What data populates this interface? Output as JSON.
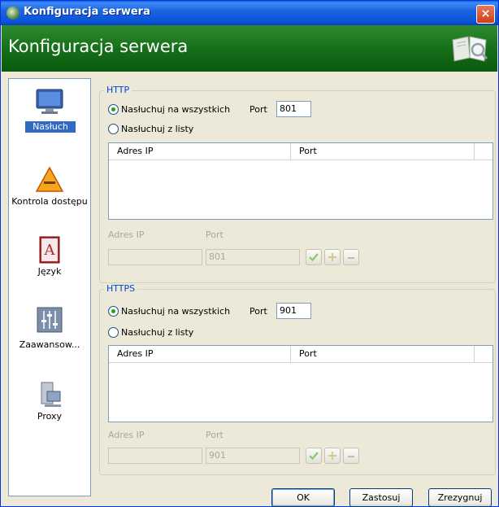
{
  "window": {
    "title": "Konfiguracja serwera",
    "close": "×"
  },
  "banner": {
    "title": "Konfiguracja serwera"
  },
  "sidebar": {
    "items": [
      {
        "label": "Nasłuch",
        "icon": "monitor-icon"
      },
      {
        "label": "Kontrola dostępu",
        "icon": "warning-icon"
      },
      {
        "label": "Język",
        "icon": "dictionary-icon"
      },
      {
        "label": "Zaawansow...",
        "icon": "sliders-icon"
      },
      {
        "label": "Proxy",
        "icon": "computer-icon"
      }
    ]
  },
  "http": {
    "title": "HTTP",
    "listen_all": "Nasłuchuj na wszystkich",
    "port_label": "Port",
    "port_value": "801",
    "listen_list": "Nasłuchuj z listy",
    "col_ip": "Adres IP",
    "col_port": "Port",
    "ip_label": "Adres IP",
    "port_label2": "Port",
    "ip_value": "",
    "port_value2": "801"
  },
  "https": {
    "title": "HTTPS",
    "listen_all": "Nasłuchuj na wszystkich",
    "port_label": "Port",
    "port_value": "901",
    "listen_list": "Nasłuchuj z listy",
    "col_ip": "Adres IP",
    "col_port": "Port",
    "ip_label": "Adres IP",
    "port_label2": "Port",
    "ip_value": "",
    "port_value2": "901"
  },
  "buttons": {
    "ok": "OK",
    "apply": "Zastosuj",
    "cancel": "Zrezygnuj"
  },
  "colors": {
    "banner": "#176f1a",
    "titlebar": "#0954d8",
    "selection": "#316ac5",
    "group_title": "#0046d5"
  }
}
